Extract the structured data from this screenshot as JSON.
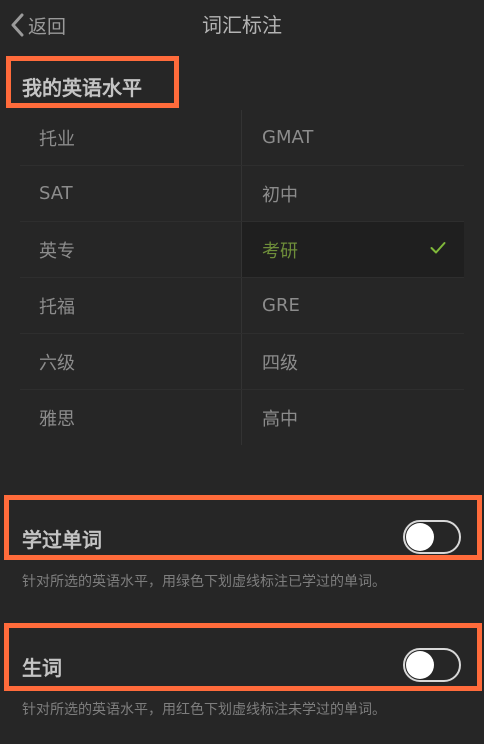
{
  "nav": {
    "back_label": "返回",
    "title": "词汇标注"
  },
  "level_section": {
    "title": "我的英语水平",
    "rows": [
      {
        "left": "托业",
        "right": "GMAT"
      },
      {
        "left": "SAT",
        "right": "初中"
      },
      {
        "left": "英专",
        "right": "考研"
      },
      {
        "left": "托福",
        "right": "GRE"
      },
      {
        "left": "六级",
        "right": "四级"
      },
      {
        "left": "雅思",
        "right": "高中"
      }
    ],
    "selected": "考研"
  },
  "learned_words": {
    "label": "学过单词",
    "enabled": false,
    "description": "针对所选的英语水平，用绿色下划虚线标注已学过的单词。"
  },
  "new_words": {
    "label": "生词",
    "enabled": false,
    "description": "针对所选的英语水平，用红色下划虚线标注未学过的单词。"
  },
  "colors": {
    "background": "#262626",
    "highlight_border": "#ff6b3b",
    "selected_text": "#6e8e3a",
    "check": "#7fb83a"
  }
}
